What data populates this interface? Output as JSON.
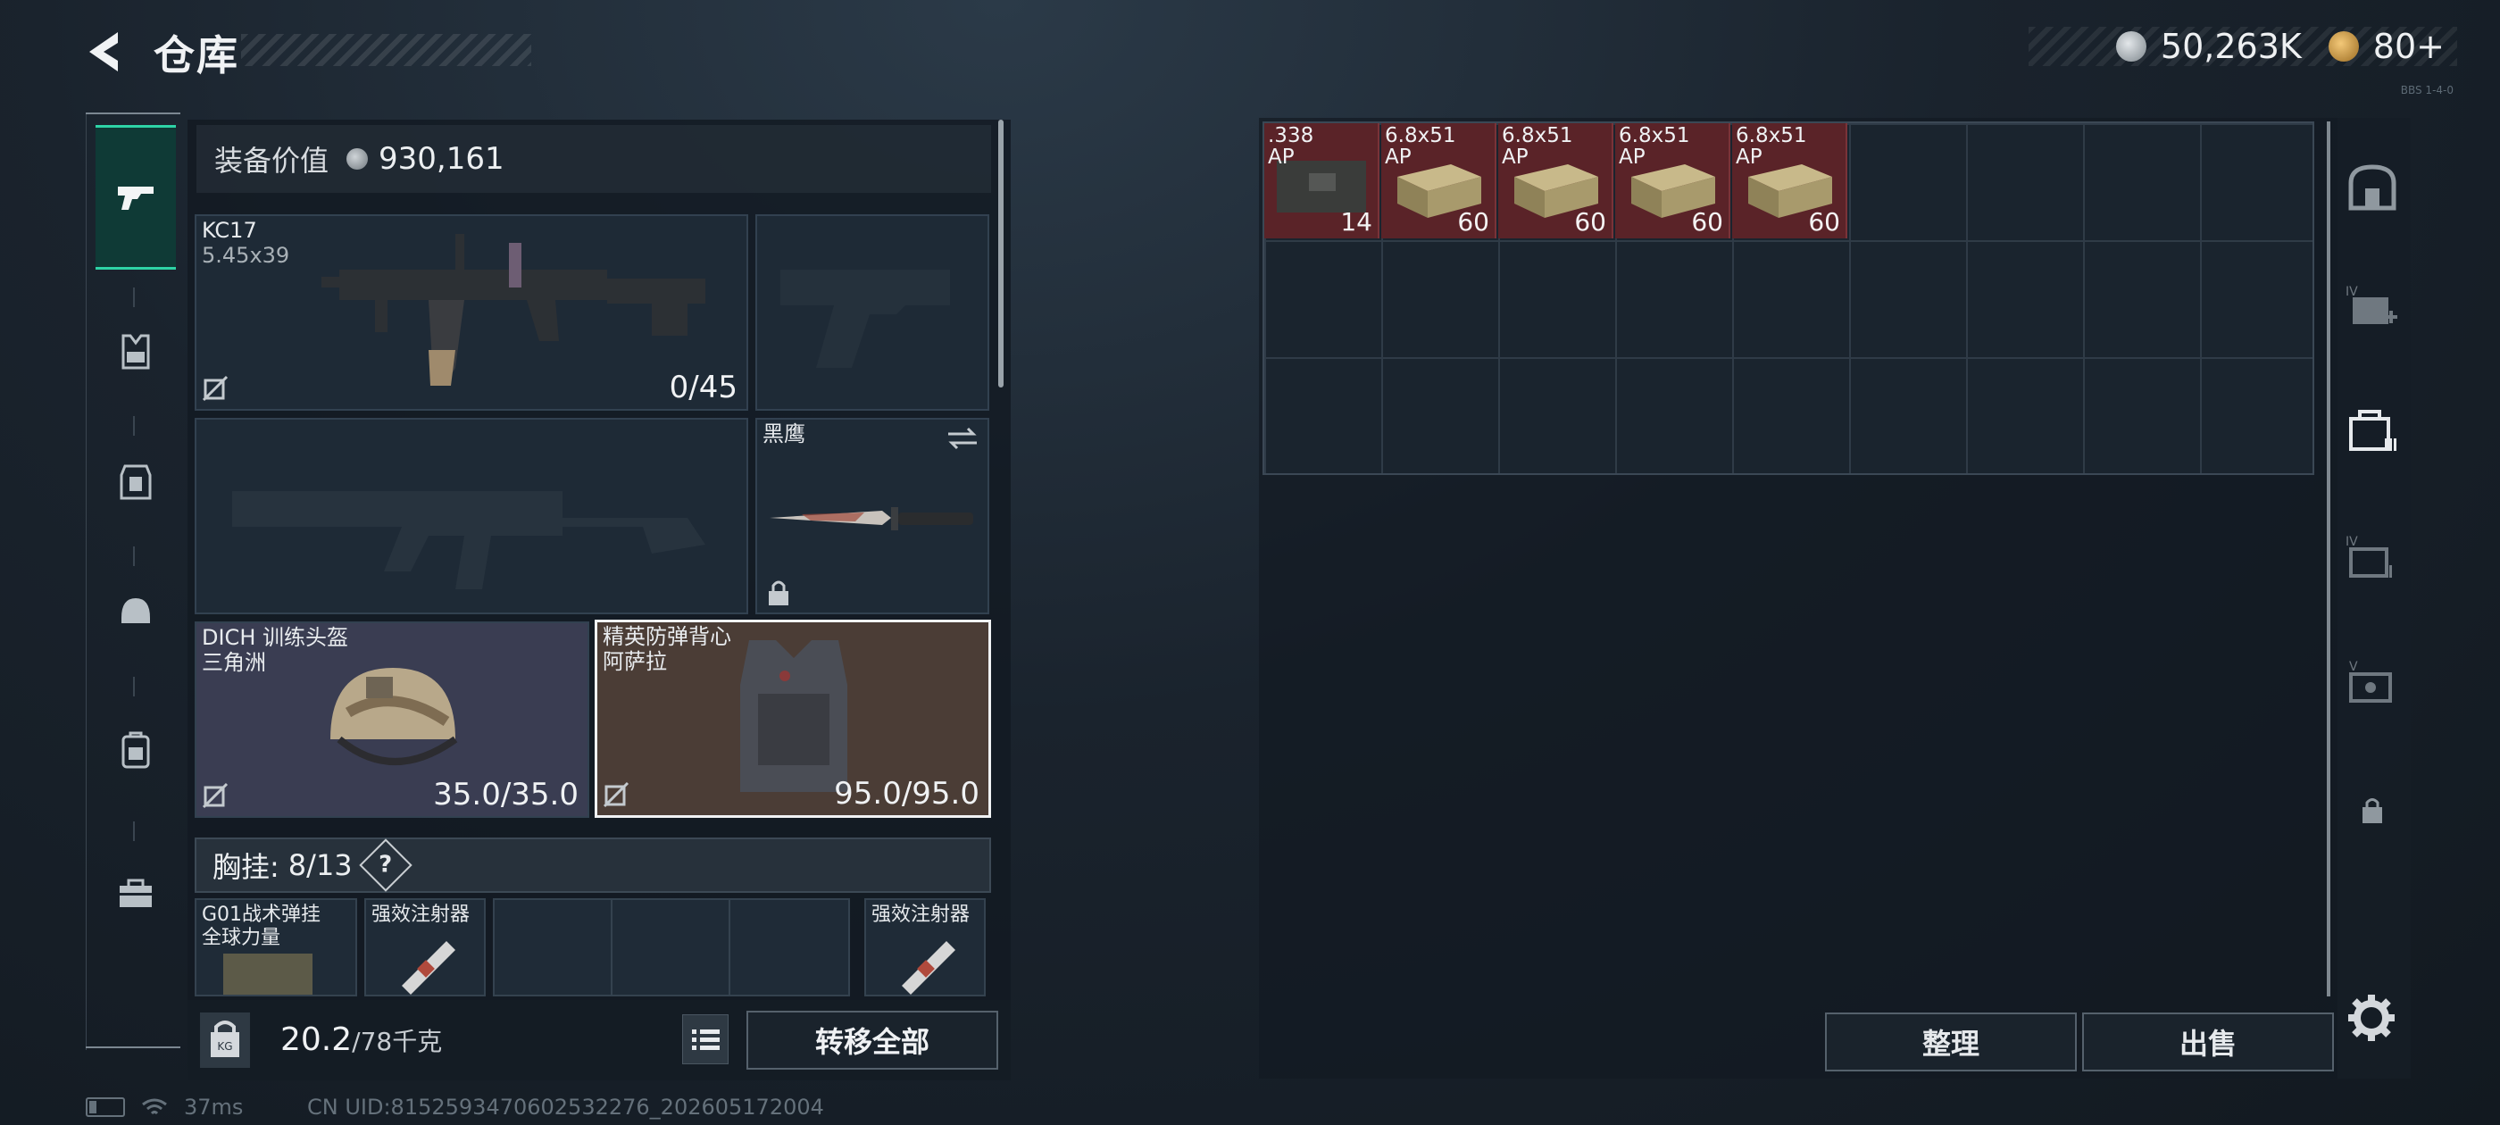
{
  "header": {
    "title": "仓库",
    "currency": [
      {
        "icon": "silver-coin-icon",
        "value": "50,263K"
      },
      {
        "icon": "gold-coin-icon",
        "value": "80+"
      }
    ],
    "build": "BBS 1-4-0"
  },
  "nav": {
    "items": [
      "gun-icon",
      "vest-icon",
      "backpack-icon",
      "helmet-icon",
      "case-icon",
      "toolbox-icon"
    ]
  },
  "loadout": {
    "value_label": "装备价值",
    "value": "930,161",
    "primary": {
      "name": "KC17",
      "caliber": "5.45x39",
      "ammo": "0/45"
    },
    "knife": {
      "name": "黑鹰"
    },
    "helmet": {
      "name": "DICH 训练头盔",
      "brand": "三角洲",
      "durability": "35.0/35.0"
    },
    "armor": {
      "name": "精英防弹背心",
      "brand": "阿萨拉",
      "durability": "95.0/95.0"
    },
    "rig": {
      "label": "胸挂:",
      "count": "8/13",
      "help": "?"
    },
    "rig_items": [
      {
        "name": "G01战术弹挂",
        "sub": "全球力量"
      },
      {
        "name": "强效注射器"
      },
      {
        "name": "强效注射器"
      }
    ],
    "weight": {
      "current": "20.2",
      "max": "/78千克"
    },
    "transfer_all": "转移全部"
  },
  "storage": {
    "items": [
      {
        "caliber": ".338",
        "type": "AP",
        "count": "14"
      },
      {
        "caliber": "6.8x51",
        "type": "AP",
        "count": "60"
      },
      {
        "caliber": "6.8x51",
        "type": "AP",
        "count": "60"
      },
      {
        "caliber": "6.8x51",
        "type": "AP",
        "count": "60"
      },
      {
        "caliber": "6.8x51",
        "type": "AP",
        "count": "60"
      }
    ],
    "sort": "整理",
    "sell": "出售"
  },
  "status": {
    "ping": "37ms",
    "uid": "CN UID:8152593470602532276_202605172004"
  },
  "colors": {
    "accent": "#2ed3a6",
    "item_highlight": "#5a2328",
    "background": "#1a232d"
  }
}
